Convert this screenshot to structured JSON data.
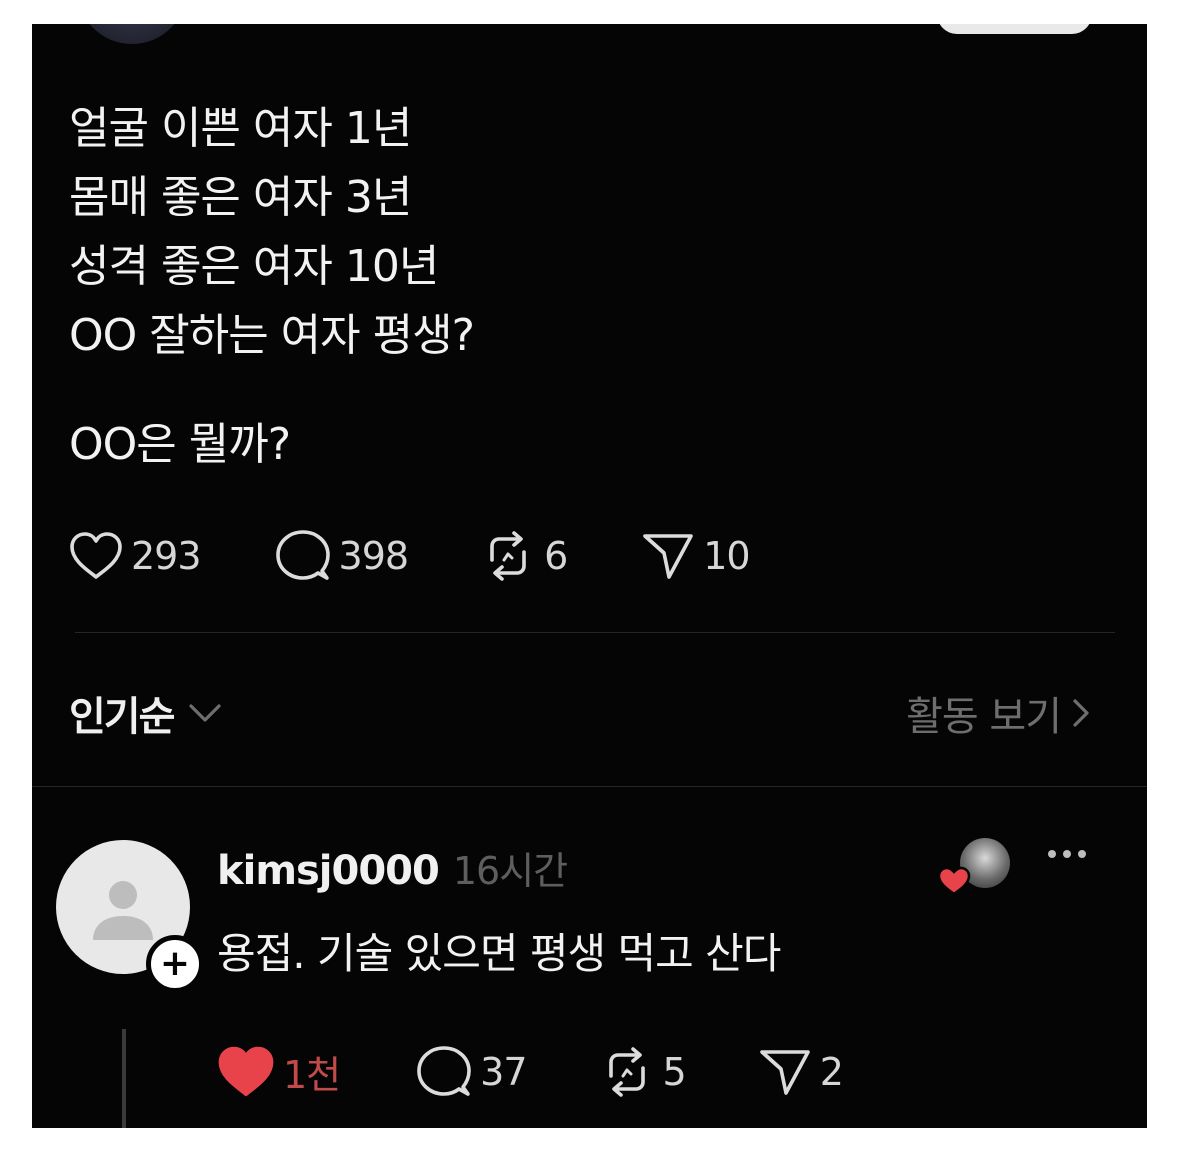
{
  "post": {
    "lines": [
      "얼굴 이쁜 여자 1년",
      "몸매 좋은 여자 3년",
      "성격 좋은 여자 10년",
      "OO 잘하는 여자 평생?",
      "OO은 뭘까?"
    ],
    "stats": {
      "likes": "293",
      "comments": "398",
      "reposts": "6",
      "shares": "10"
    }
  },
  "sort": {
    "label": "인기순",
    "activity_link": "활동 보기"
  },
  "reply": {
    "username": "kimsj0000",
    "time": "16시간",
    "text": "용접. 기술 있으면 평생 먹고 산다",
    "stats": {
      "likes": "1천",
      "comments": "37",
      "reposts": "5",
      "shares": "2"
    }
  },
  "colors": {
    "background": "#050505",
    "text": "#f2f2f2",
    "muted": "#6e6e6e",
    "like_active": "#e8434b"
  },
  "icons": {
    "like": "heart-icon",
    "comment": "comment-bubble-icon",
    "repost": "repost-icon",
    "share": "send-icon",
    "sort_dropdown": "chevron-down-icon",
    "activity": "chevron-right-icon",
    "follow": "plus-icon",
    "more": "more-dots-icon"
  }
}
